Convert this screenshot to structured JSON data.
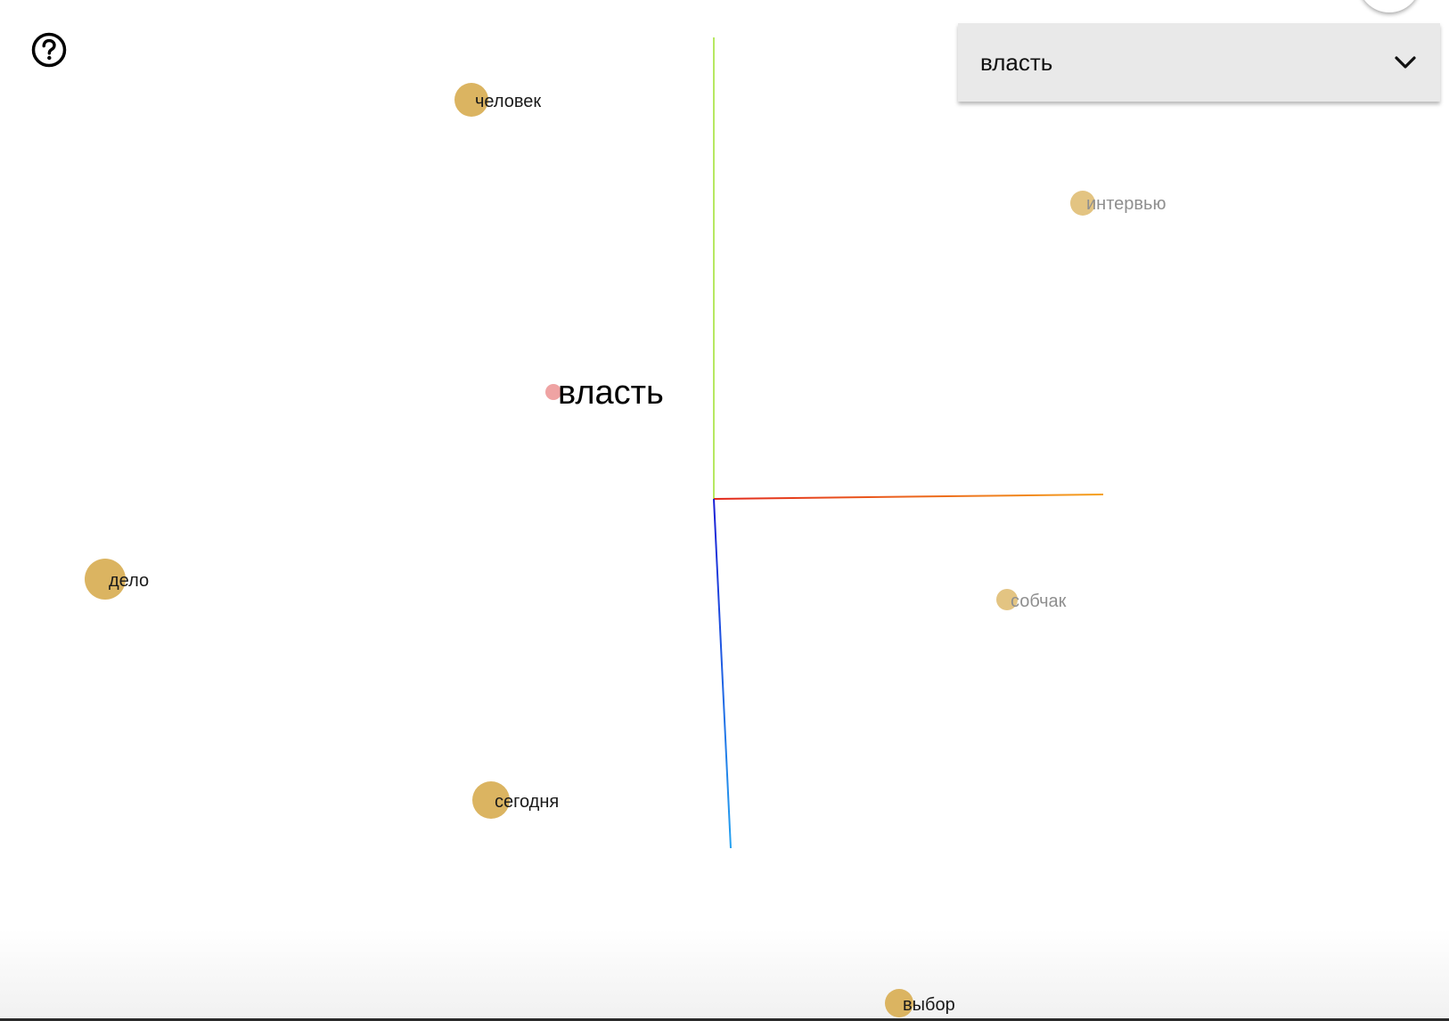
{
  "selector": {
    "selected_word": "власть"
  },
  "help": {
    "icon": "question-circle-icon"
  },
  "colors": {
    "point": "#dbb461",
    "point_faded": "#e3c482",
    "query_point": "#efa3a3",
    "axis_x_start": "#e2261c",
    "axis_x_end": "#f5a11d",
    "axis_y_start": "#9fe12e",
    "axis_y_end": "#9fe12e",
    "axis_z_start": "#1b1fd6",
    "axis_z_end": "#25a2f0"
  },
  "scene": {
    "query": {
      "word": "власть"
    },
    "neighbors": [
      {
        "word": "человек",
        "faded": false
      },
      {
        "word": "интервью",
        "faded": true
      },
      {
        "word": "дело",
        "faded": false
      },
      {
        "word": "собчак",
        "faded": true
      },
      {
        "word": "сегодня",
        "faded": false
      },
      {
        "word": "выбор",
        "faded": false
      }
    ]
  }
}
